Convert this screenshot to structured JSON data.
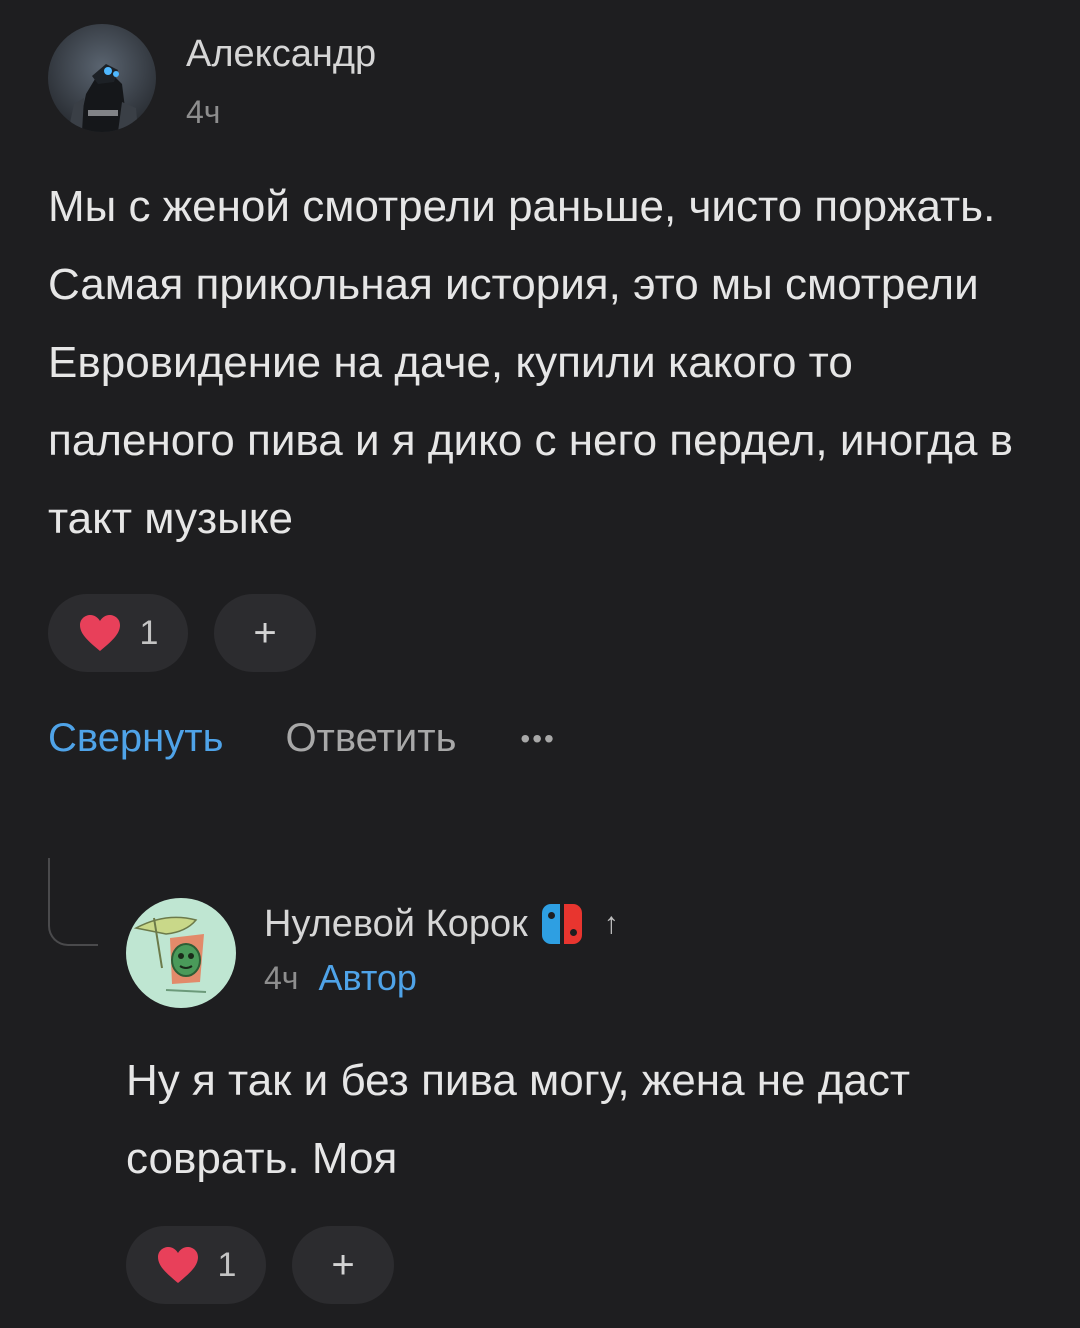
{
  "comments": [
    {
      "author": "Александр",
      "time": "4ч",
      "text": "Мы с женой смотрели раньше, чисто поржать. Самая прикольная история, это мы смотрели Евровидение на даче, купили какого то паленого пива и я дико с него пердел, иногда в такт музыке",
      "likes": "1",
      "add_label": "+",
      "collapse_label": "Свернуть",
      "reply_label": "Ответить",
      "more_label": "•••"
    },
    {
      "author": "Нулевой Корок",
      "time": "4ч",
      "badge": "Автор",
      "arrow": "↑",
      "text": "Ну я так и без пива могу, жена не даст соврать. Моя",
      "likes": "1",
      "add_label": "+"
    }
  ],
  "icons": {
    "heart": "heart-icon",
    "switch": "nintendo-switch-icon",
    "more": "more-icon"
  },
  "colors": {
    "background": "#1e1e20",
    "accent": "#4fa3e8",
    "heart": "#e8405a"
  }
}
